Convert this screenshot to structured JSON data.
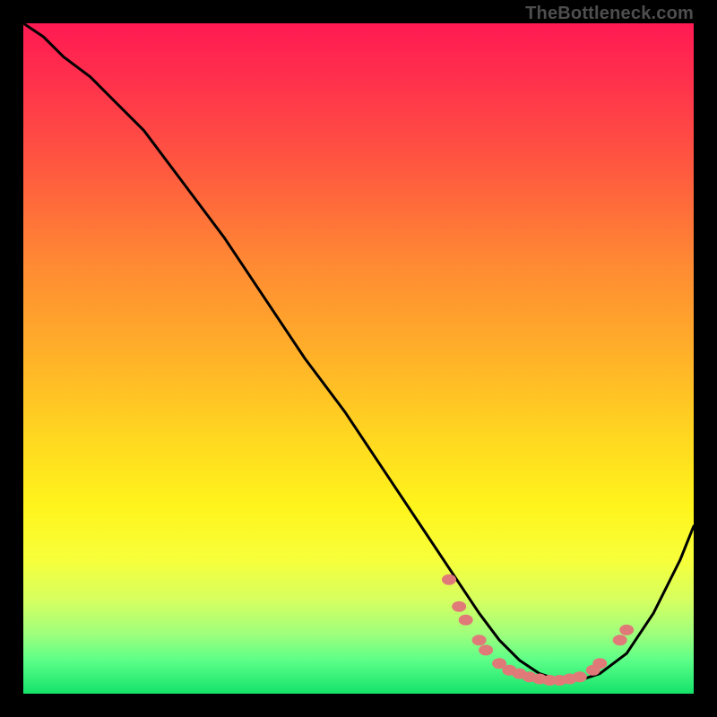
{
  "attribution": "TheBottleneck.com",
  "colors": {
    "frame": "#000000",
    "curve": "#000000",
    "marker_border": "#e07a78",
    "marker_fill": "#e07a78",
    "gradient_stops": [
      "#ff1a52",
      "#ff2f4d",
      "#ff5a3f",
      "#ff8a33",
      "#ffb228",
      "#ffd820",
      "#fff41c",
      "#f7ff3a",
      "#d6ff60",
      "#a0ff7c",
      "#5cff88",
      "#14e26a"
    ]
  },
  "chart_data": {
    "type": "line",
    "title": "",
    "xlabel": "",
    "ylabel": "",
    "xlim": [
      0,
      100
    ],
    "ylim": [
      0,
      100
    ],
    "grid": false,
    "legend": false,
    "series": [
      {
        "name": "curve",
        "x": [
          0,
          3,
          6,
          10,
          14,
          18,
          24,
          30,
          36,
          42,
          48,
          54,
          60,
          64,
          68,
          71,
          74,
          77,
          80,
          83,
          86,
          90,
          94,
          98,
          100
        ],
        "y": [
          100,
          98,
          95,
          92,
          88,
          84,
          76,
          68,
          59,
          50,
          42,
          33,
          24,
          18,
          12,
          8,
          5,
          3,
          2,
          2,
          3,
          6,
          12,
          20,
          25
        ]
      }
    ],
    "markers": [
      {
        "x": 63.5,
        "y": 17
      },
      {
        "x": 65.0,
        "y": 13
      },
      {
        "x": 66.0,
        "y": 11
      },
      {
        "x": 68.0,
        "y": 8
      },
      {
        "x": 69.0,
        "y": 6.5
      },
      {
        "x": 71.0,
        "y": 4.5
      },
      {
        "x": 72.5,
        "y": 3.5
      },
      {
        "x": 74.0,
        "y": 3
      },
      {
        "x": 75.5,
        "y": 2.5
      },
      {
        "x": 77.0,
        "y": 2.2
      },
      {
        "x": 78.5,
        "y": 2
      },
      {
        "x": 80.0,
        "y": 2
      },
      {
        "x": 81.5,
        "y": 2.2
      },
      {
        "x": 83.0,
        "y": 2.5
      },
      {
        "x": 85.0,
        "y": 3.5
      },
      {
        "x": 86.0,
        "y": 4.5
      },
      {
        "x": 89.0,
        "y": 8
      },
      {
        "x": 90.0,
        "y": 9.5
      }
    ]
  }
}
